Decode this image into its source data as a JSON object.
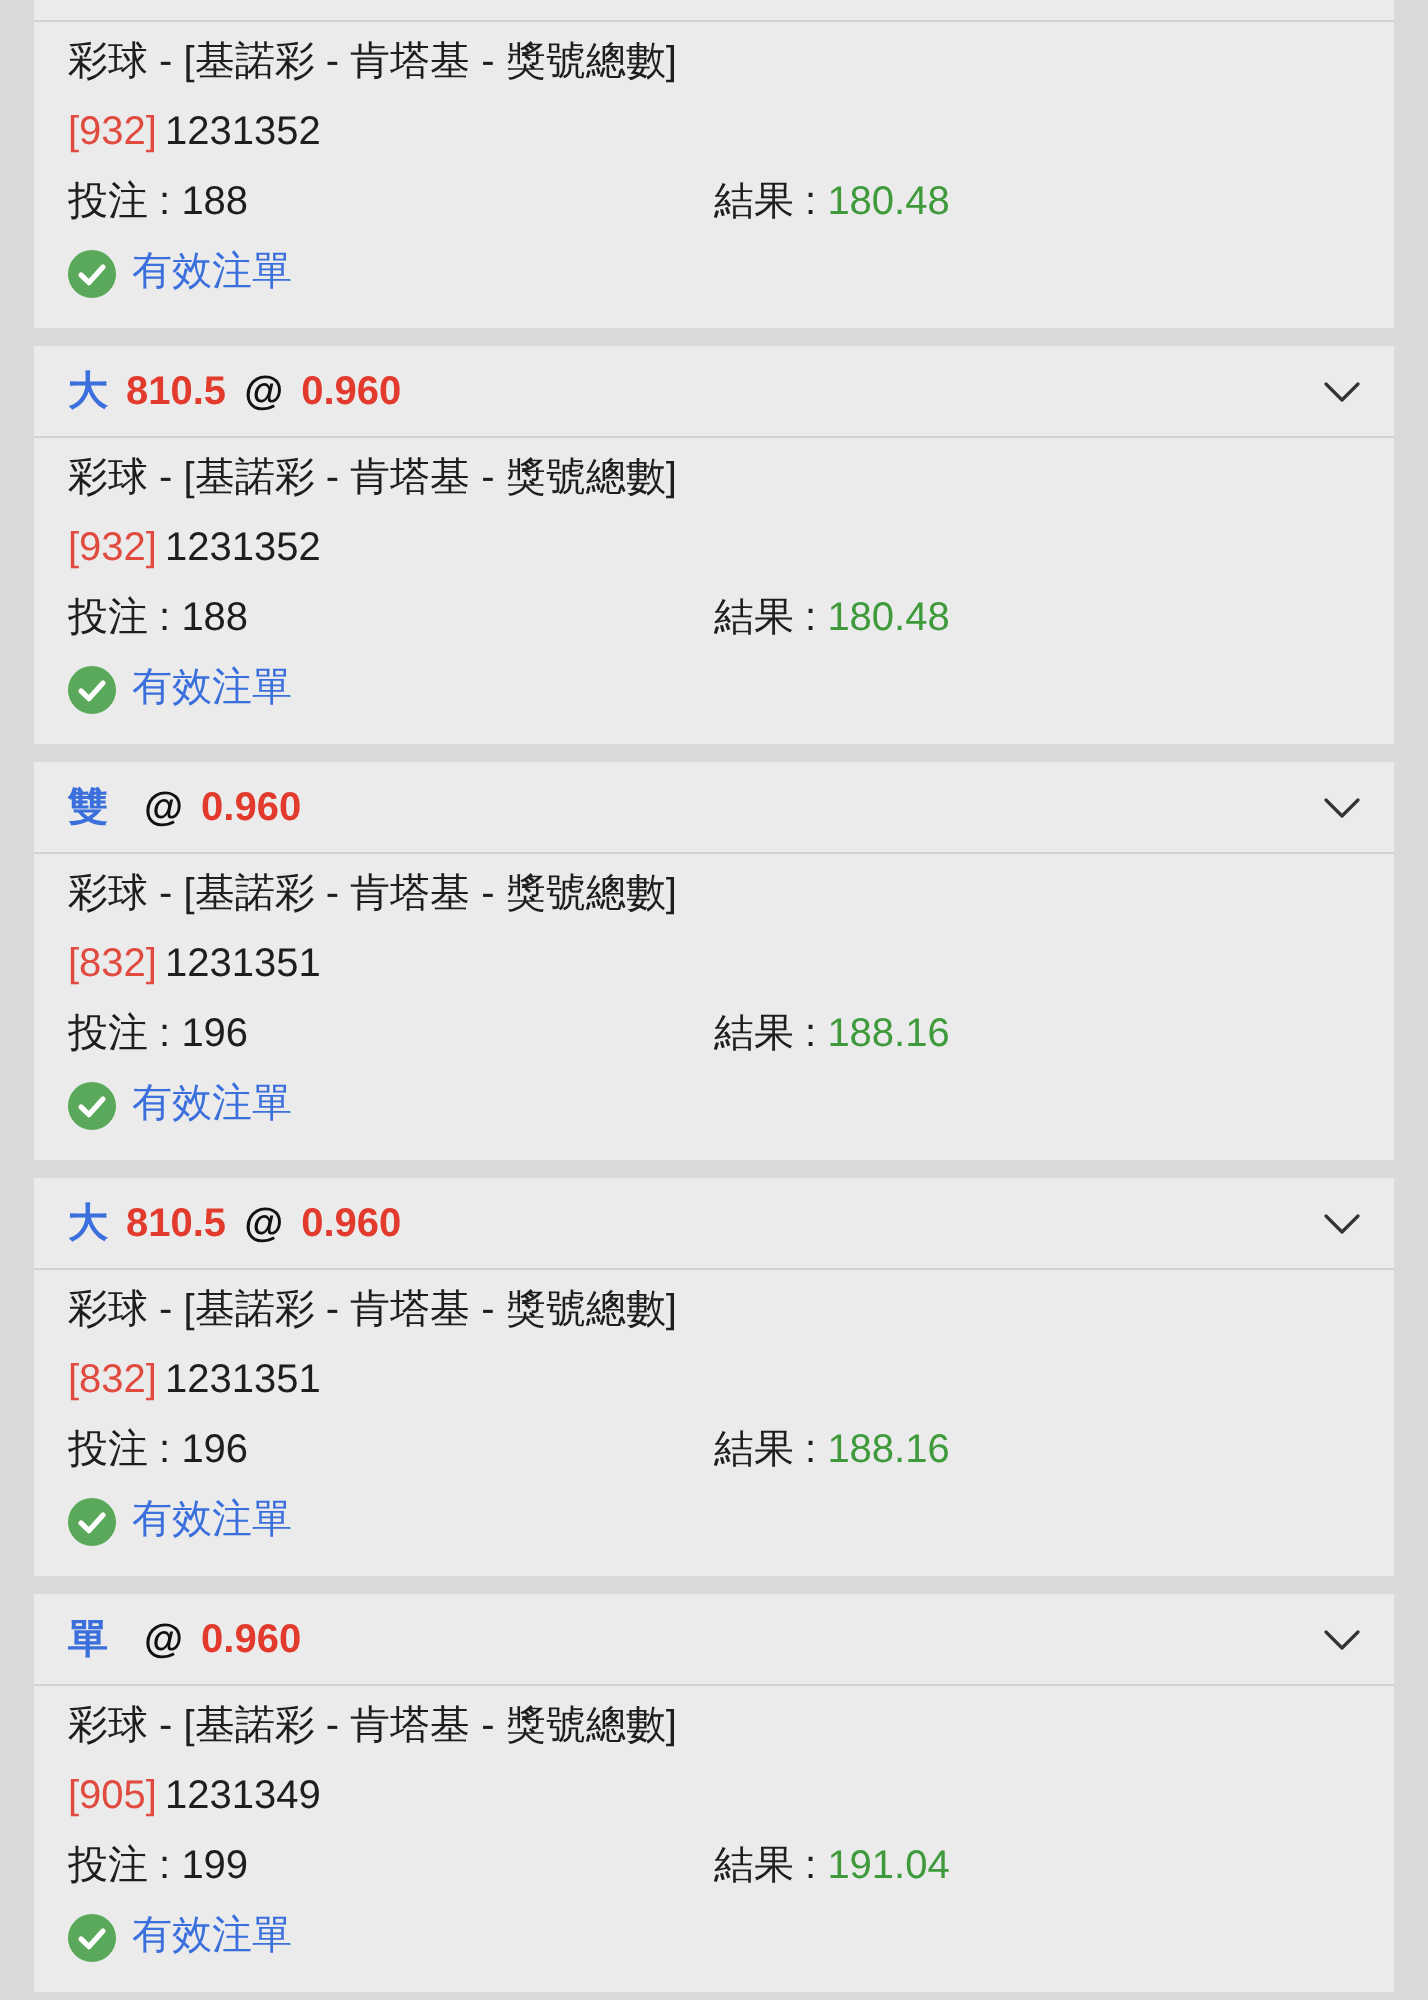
{
  "bets": [
    {
      "body": {
        "game": "彩球 - [基諾彩 - 肯塔基 - 獎號總數]",
        "draw_no": "[932]",
        "bet_id": "1231352",
        "stake_label": "投注 :",
        "stake": "188",
        "result_label": "結果 :",
        "result": "180.48",
        "status": "有效注單"
      }
    },
    {
      "header": {
        "pick": "大",
        "line": "810.5",
        "at": "@",
        "odds": "0.960"
      },
      "body": {
        "game": "彩球 - [基諾彩 - 肯塔基 - 獎號總數]",
        "draw_no": "[932]",
        "bet_id": "1231352",
        "stake_label": "投注 :",
        "stake": "188",
        "result_label": "結果 :",
        "result": "180.48",
        "status": "有效注單"
      }
    },
    {
      "header": {
        "pick": "雙",
        "at": "@",
        "odds": "0.960"
      },
      "body": {
        "game": "彩球 - [基諾彩 - 肯塔基 - 獎號總數]",
        "draw_no": "[832]",
        "bet_id": "1231351",
        "stake_label": "投注 :",
        "stake": "196",
        "result_label": "結果 :",
        "result": "188.16",
        "status": "有效注單"
      }
    },
    {
      "header": {
        "pick": "大",
        "line": "810.5",
        "at": "@",
        "odds": "0.960"
      },
      "body": {
        "game": "彩球 - [基諾彩 - 肯塔基 - 獎號總數]",
        "draw_no": "[832]",
        "bet_id": "1231351",
        "stake_label": "投注 :",
        "stake": "196",
        "result_label": "結果 :",
        "result": "188.16",
        "status": "有效注單"
      }
    },
    {
      "header": {
        "pick": "單",
        "at": "@",
        "odds": "0.960"
      },
      "body": {
        "game": "彩球 - [基諾彩 - 肯塔基 - 獎號總數]",
        "draw_no": "[905]",
        "bet_id": "1231349",
        "stake_label": "投注 :",
        "stake": "199",
        "result_label": "結果 :",
        "result": "191.04",
        "status": "有效注單"
      }
    }
  ]
}
